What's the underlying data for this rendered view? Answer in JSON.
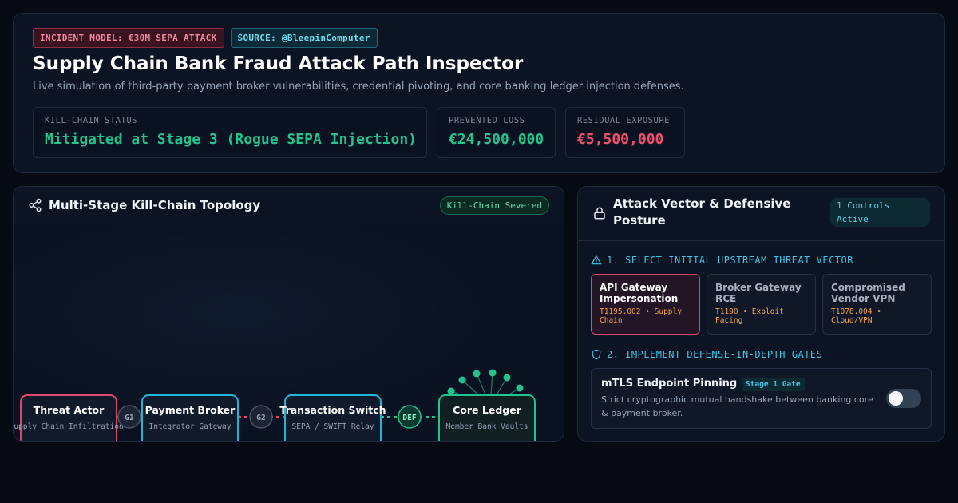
{
  "header": {
    "badge_incident": "INCIDENT MODEL: €30M SEPA ATTACK",
    "badge_source": "SOURCE: @BleepinComputer",
    "title": "Supply Chain Bank Fraud Attack Path Inspector",
    "subtitle": "Live simulation of third-party payment broker vulnerabilities, credential pivoting, and core banking ledger injection defenses.",
    "stats": [
      {
        "label": "KILL-CHAIN STATUS",
        "value": "Mitigated at Stage 3 (Rogue SEPA Injection)",
        "color": "#22c38e"
      },
      {
        "label": "PREVENTED LOSS",
        "value": "€24,500,000",
        "color": "#22c38e"
      },
      {
        "label": "RESIDUAL EXPOSURE",
        "value": "€5,500,000",
        "color": "#f0506e"
      }
    ]
  },
  "topology": {
    "title": "Multi-Stage Kill-Chain Topology",
    "status_badge": "Kill-Chain Severed",
    "nodes": [
      {
        "title": "Threat Actor",
        "sub": "upply Chain Infiltration",
        "color": "#e0466a"
      },
      {
        "title": "Payment Broker",
        "sub": "Integrator Gateway",
        "color": "#22b5d6"
      },
      {
        "title": "Transaction Switch",
        "sub": "SEPA / SWIFT Relay",
        "color": "#22b5d6"
      },
      {
        "title": "Core Ledger",
        "sub": "Member Bank Vaults",
        "color": "#22c38e"
      }
    ],
    "gates": [
      "G1",
      "G2",
      "DEF"
    ]
  },
  "defense": {
    "title": "Attack Vector & Defensive Posture",
    "active_badge": "1 Controls Active",
    "section1": "1. SELECT INITIAL UPSTREAM THREAT VECTOR",
    "vectors": [
      {
        "name": "API Gateway Impersonation",
        "tech": "T1195.002 • Supply Chain",
        "selected": true
      },
      {
        "name": "Broker Gateway RCE",
        "tech": "T1190 • Exploit Facing",
        "selected": false
      },
      {
        "name": "Compromised Vendor VPN",
        "tech": "T1078.004 • Cloud/VPN",
        "selected": false
      }
    ],
    "section2": "2. IMPLEMENT DEFENSE-IN-DEPTH GATES",
    "gates": [
      {
        "title": "mTLS Endpoint Pinning",
        "tag": "Stage 1 Gate",
        "desc": "Strict cryptographic mutual handshake between banking core & payment broker.",
        "enabled": false
      }
    ]
  }
}
